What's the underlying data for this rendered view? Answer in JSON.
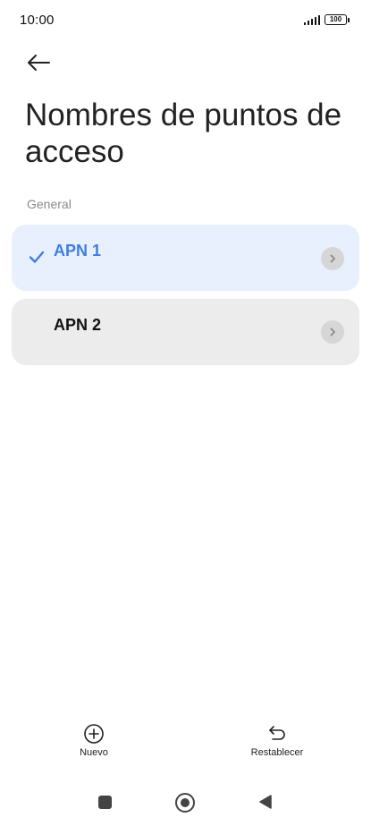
{
  "status_bar": {
    "time": "10:00",
    "battery": "100"
  },
  "header": {
    "back_icon": "arrow-left-icon",
    "title": "Nombres de puntos de acceso"
  },
  "section": {
    "label": "General"
  },
  "apn_list": [
    {
      "name": "APN 1",
      "selected": true
    },
    {
      "name": "APN 2",
      "selected": false
    }
  ],
  "actions": {
    "new_label": "Nuevo",
    "reset_label": "Restablecer"
  },
  "colors": {
    "accent": "#3f7ee0",
    "selected_bg": "#e8f0fe",
    "item_bg": "#ececec"
  }
}
